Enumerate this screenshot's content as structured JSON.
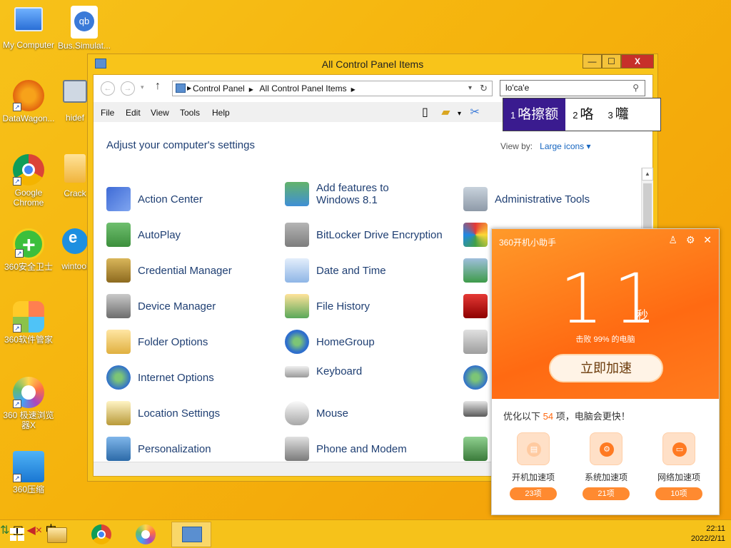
{
  "desktop": {
    "icons": [
      {
        "label": "My Computer"
      },
      {
        "label": "Bus.Simulat..."
      },
      {
        "label": "DataWagon..."
      },
      {
        "label": "hidef"
      },
      {
        "label": "Google Chrome"
      },
      {
        "label": "Crack"
      },
      {
        "label": "360安全卫士"
      },
      {
        "label": "wintool"
      },
      {
        "label": "360软件管家"
      },
      {
        "label": "360 极速浏览器X"
      },
      {
        "label": "360压缩"
      }
    ]
  },
  "window": {
    "title": "All Control Panel Items",
    "minimize": "—",
    "maximize": "☐",
    "close": "X",
    "breadcrumb": [
      "Control Panel",
      "All Control Panel Items"
    ],
    "search_value": "lo'ca'e",
    "ime": {
      "candidates": [
        {
          "num": "1",
          "text": "咯擦额"
        },
        {
          "num": "2",
          "text": "咯"
        },
        {
          "num": "3",
          "text": "囖"
        }
      ]
    },
    "menu": [
      "File",
      "Edit",
      "View",
      "Tools",
      "Help"
    ],
    "heading": "Adjust your computer's settings",
    "view_by_label": "View by:",
    "view_by_value": "Large icons ▾",
    "items": [
      {
        "label": "Action Center"
      },
      {
        "label": "Add features to Windows 8.1"
      },
      {
        "label": "Administrative Tools"
      },
      {
        "label": "AutoPlay"
      },
      {
        "label": "BitLocker Drive Encryption"
      },
      {
        "label": ""
      },
      {
        "label": "Credential Manager"
      },
      {
        "label": "Date and Time"
      },
      {
        "label": ""
      },
      {
        "label": "Device Manager"
      },
      {
        "label": "File History"
      },
      {
        "label": ""
      },
      {
        "label": "Folder Options"
      },
      {
        "label": "HomeGroup"
      },
      {
        "label": ""
      },
      {
        "label": "Internet Options"
      },
      {
        "label": "Keyboard"
      },
      {
        "label": ""
      },
      {
        "label": "Location Settings"
      },
      {
        "label": "Mouse"
      },
      {
        "label": ""
      },
      {
        "label": "Personalization"
      },
      {
        "label": "Phone and Modem"
      },
      {
        "label": ""
      }
    ]
  },
  "panel360": {
    "title": "360开机小助手",
    "seconds": "11",
    "unit": "秒",
    "beat_text": "击败 99% 的电脑",
    "boost_button": "立即加速",
    "tip_prefix": "优化以下",
    "tip_count": "54",
    "tip_suffix": "项，电脑会更快！",
    "categories": [
      {
        "label": "开机加速项",
        "count": "23项"
      },
      {
        "label": "系统加速项",
        "count": "21项"
      },
      {
        "label": "网络加速项",
        "count": "10项"
      }
    ]
  },
  "taskbar": {
    "ime_indicator": "中",
    "time": "22:11",
    "date": "2022/2/11"
  }
}
